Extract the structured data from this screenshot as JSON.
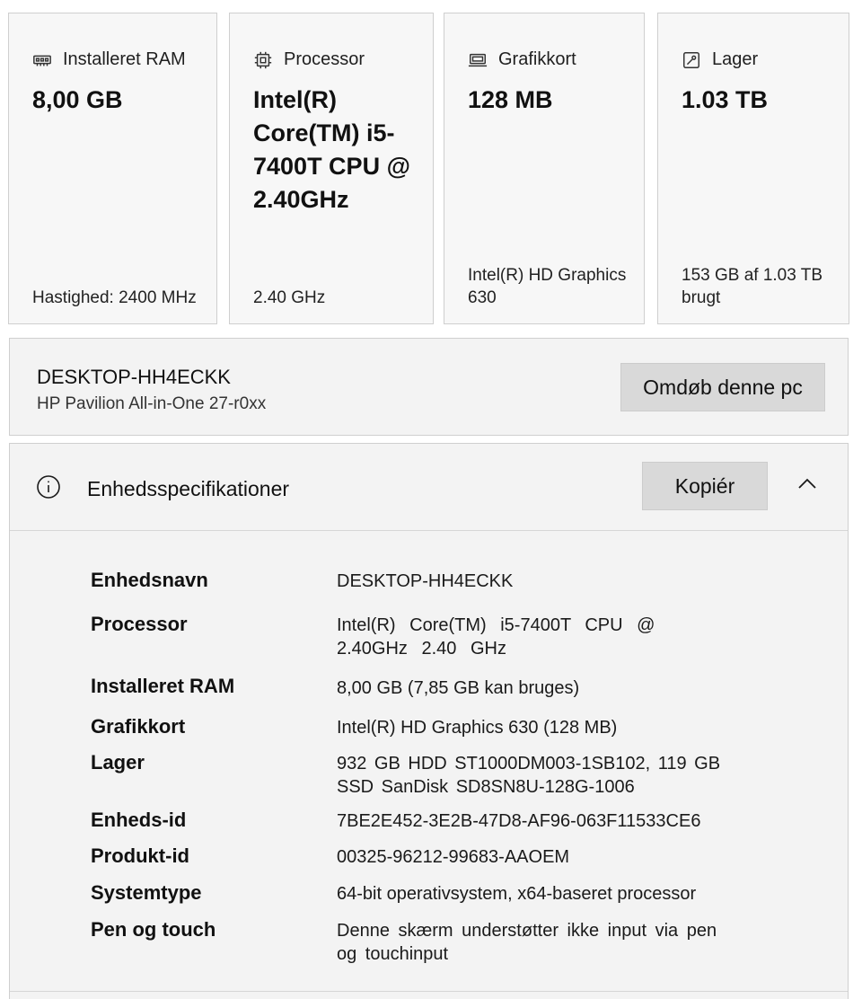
{
  "cards": [
    {
      "label": "Installeret RAM",
      "icon": "ram-icon",
      "value": "8,00 GB",
      "footer": "Hastighed: 2400 MHz"
    },
    {
      "label": "Processor",
      "icon": "processor-icon",
      "value": "Intel(R) Core(TM) i5-7400T CPU @ 2.40GHz",
      "footer": "2.40 GHz"
    },
    {
      "label": "Grafikkort",
      "icon": "graphics-card-icon",
      "value": "128 MB",
      "footer": "Intel(R) HD Graphics 630"
    },
    {
      "label": "Lager",
      "icon": "storage-icon",
      "value": "1.03 TB",
      "footer": "153 GB af 1.03 TB brugt"
    }
  ],
  "device": {
    "name": "DESKTOP-HH4ECKK",
    "model": "HP Pavilion All-in-One 27-r0xx",
    "rename_label": "Omdøb denne pc"
  },
  "specs": {
    "title": "Enhedsspecifikationer",
    "copy_label": "Kopiér",
    "icon": "info-icon",
    "rows": [
      {
        "label": "Enhedsnavn",
        "value": "DESKTOP-HH4ECKK"
      },
      {
        "label": "Processor",
        "value": "Intel(R) Core(TM) i5-7400T CPU @ 2.40GHz 2.40 GHz"
      },
      {
        "label": "Installeret RAM",
        "value": "8,00 GB (7,85 GB kan bruges)"
      },
      {
        "label": "Grafikkort",
        "value": "Intel(R) HD Graphics 630 (128 MB)"
      },
      {
        "label": "Lager",
        "value": "932 GB HDD ST1000DM003-1SB102, 119 GB SSD SanDisk SD8SN8U-128G-1006"
      },
      {
        "label": "Enheds-id",
        "value": "7BE2E452-3E2B-47D8-AF96-063F11533CE6"
      },
      {
        "label": "Produkt-id",
        "value": "00325-96212-99683-AAOEM"
      },
      {
        "label": "Systemtype",
        "value": "64-bit operativsystem, x64-baseret processor"
      },
      {
        "label": "Pen og touch",
        "value": "Denne skærm understøtter ikke input via pen og touchinput"
      }
    ]
  }
}
